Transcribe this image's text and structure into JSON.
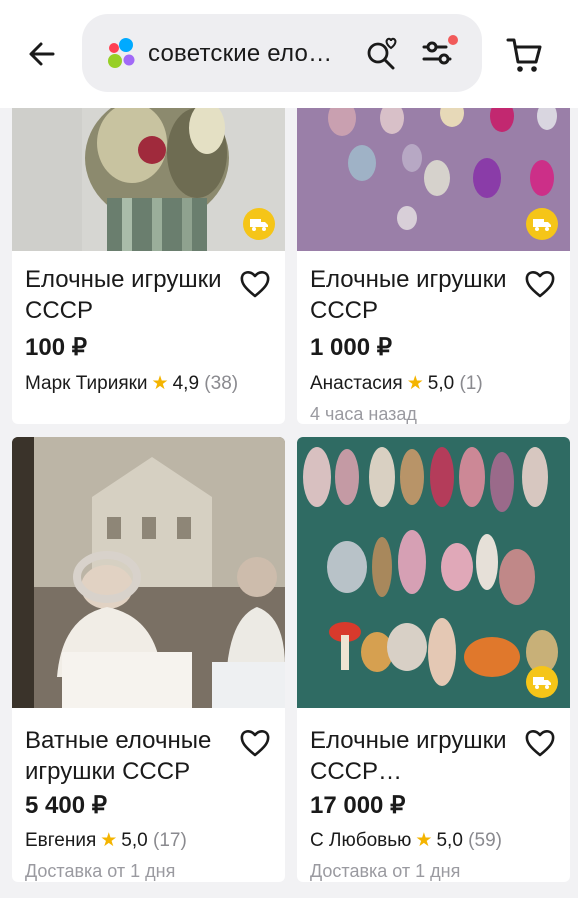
{
  "header": {
    "search_query": "советские ело…",
    "icons": [
      "back-arrow-icon",
      "app-logo-icon",
      "saved-search-icon",
      "filters-icon",
      "cart-icon"
    ]
  },
  "colors": {
    "accent": "#f5c518",
    "star": "#f4b400",
    "filter_dot": "#f15a5a"
  },
  "listings": [
    {
      "title": "Елочные игрушки СССР",
      "price": "100 ₽",
      "seller": "Марк Тирияки",
      "rating": "4,9",
      "reviews": "(38)",
      "meta": ""
    },
    {
      "title": "Елочные игрушки СССР",
      "price": "1 000 ₽",
      "seller": "Анастасия",
      "rating": "5,0",
      "reviews": "(1)",
      "meta": "4 часа назад"
    },
    {
      "title": "Ватные елочные игрушки СССР",
      "price": "5 400 ₽",
      "seller": "Евгения",
      "rating": "5,0",
      "reviews": "(17)",
      "meta": "Доставка от 1 дня"
    },
    {
      "title": "Елочные игрушки СССР…",
      "price": "17 000 ₽",
      "seller": "С Любовью",
      "rating": "5,0",
      "reviews": "(59)",
      "meta": "Доставка от 1 дня"
    }
  ]
}
